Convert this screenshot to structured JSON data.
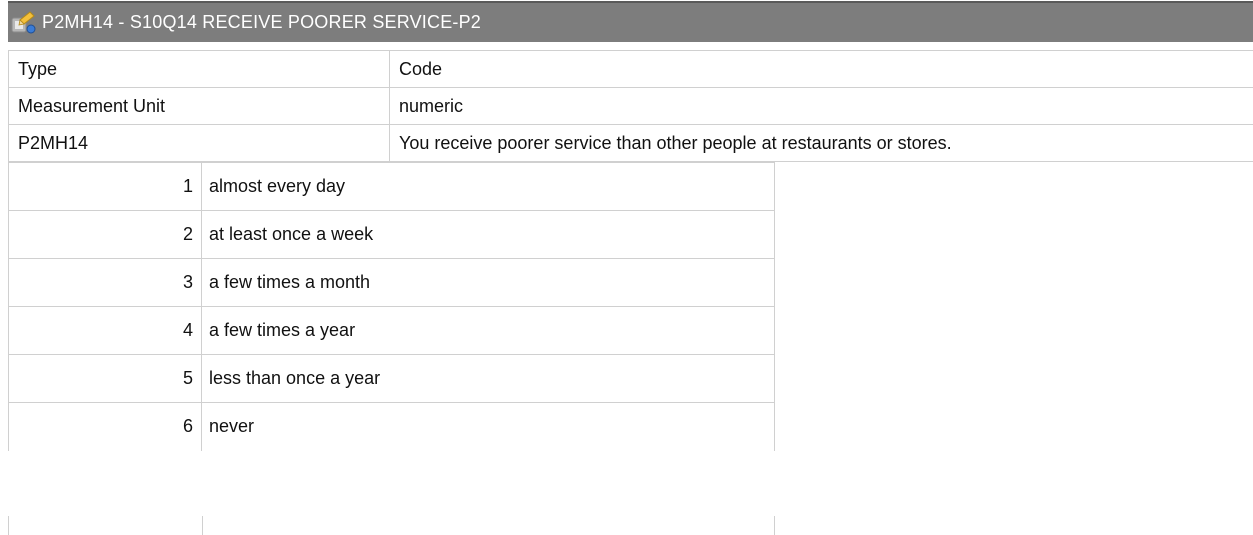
{
  "header": {
    "icon": "variable-edit-icon",
    "title": "P2MH14 - S10Q14 RECEIVE POORER SERVICE-P2"
  },
  "meta": [
    {
      "key": "Type",
      "value": "Code"
    },
    {
      "key": "Measurement Unit",
      "value": "numeric"
    },
    {
      "key": "P2MH14",
      "value": "You receive poorer service than other people at restaurants or stores."
    }
  ],
  "codes": [
    {
      "code": "1",
      "label": "almost every day"
    },
    {
      "code": "2",
      "label": "at least once a week"
    },
    {
      "code": "3",
      "label": "a few times a month"
    },
    {
      "code": "4",
      "label": "a few times a year"
    },
    {
      "code": "5",
      "label": "less than once a year"
    },
    {
      "code": "6",
      "label": "never"
    }
  ]
}
